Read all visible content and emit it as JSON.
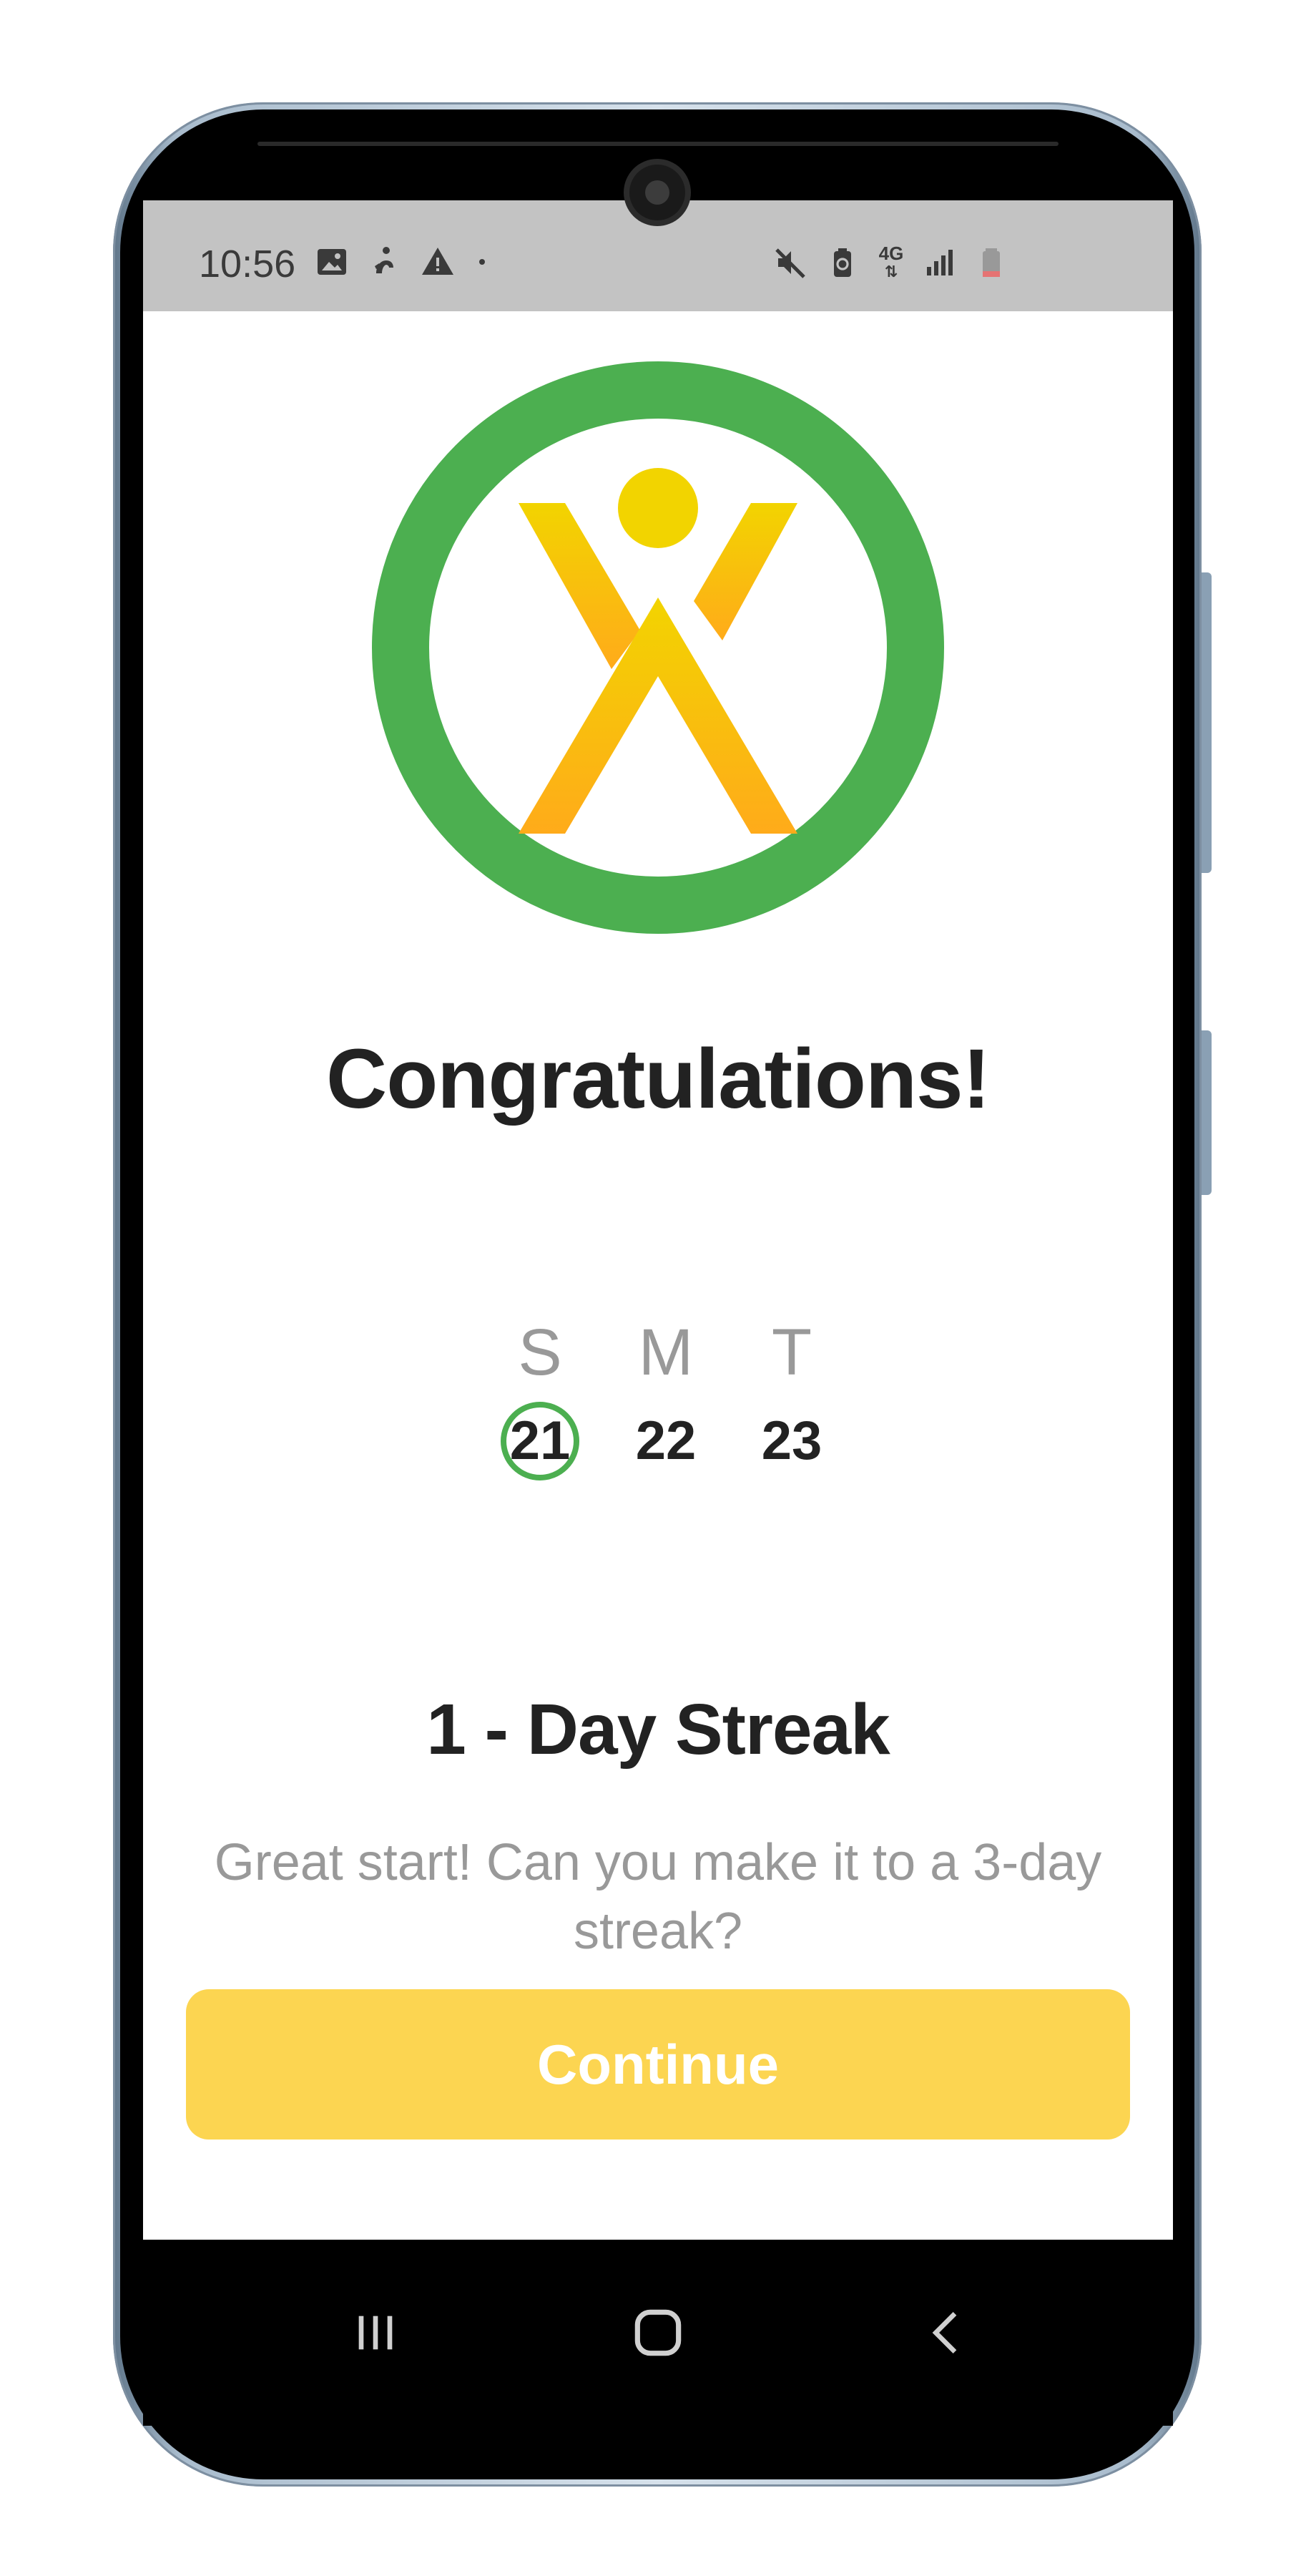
{
  "status_bar": {
    "time": "10:56",
    "left_icons": [
      "gallery-icon",
      "accessibility-icon",
      "warning-icon",
      "dot-icon"
    ],
    "right_icons": [
      "mute-icon",
      "battery-saver-icon",
      "network-4g-icon",
      "signal-icon",
      "battery-icon"
    ],
    "network_label": "4G"
  },
  "logo": {
    "ring_color": "#4caf50",
    "figure_color_top": "#f2d400",
    "figure_color_bottom": "#ffab1a"
  },
  "headline": "Congratulations!",
  "week": {
    "days": [
      {
        "letter": "S",
        "number": "21",
        "active": true
      },
      {
        "letter": "M",
        "number": "22",
        "active": false
      },
      {
        "letter": "T",
        "number": "23",
        "active": false
      }
    ],
    "active_color": "#4caf50"
  },
  "streak": {
    "title": "1 - Day Streak",
    "subtitle": "Great start! Can you make it to a 3-day streak?"
  },
  "continue_button": {
    "label": "Continue",
    "color": "#fcd551"
  },
  "nav": {
    "items": [
      "recent-apps-icon",
      "home-icon",
      "back-icon"
    ]
  }
}
